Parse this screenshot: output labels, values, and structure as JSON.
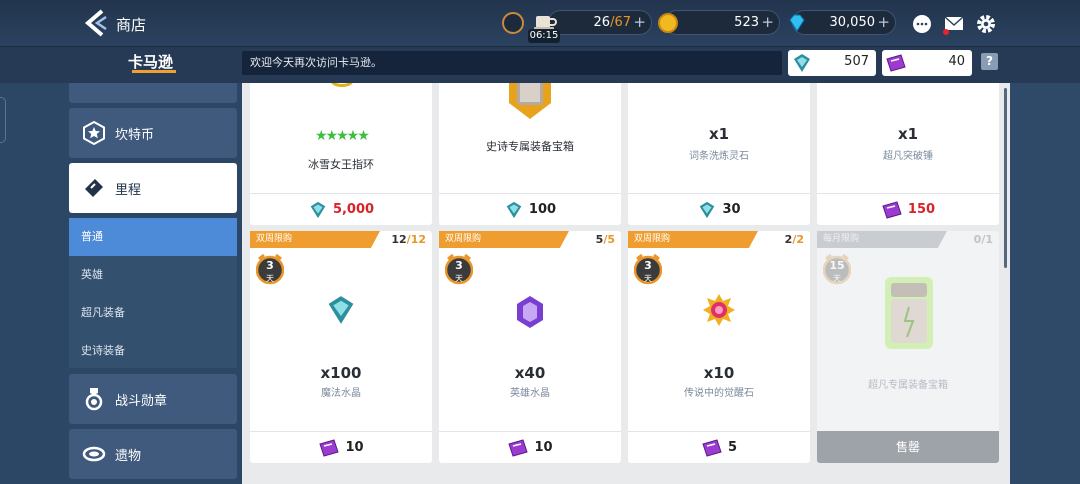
{
  "header": {
    "title": "商店",
    "energy": {
      "value": "26",
      "max": "67",
      "timer": "06:15"
    },
    "coins": "523",
    "gems": "30,050"
  },
  "subheader": {
    "brand": "卡马逊",
    "welcome": "欢迎今天再次访问卡马逊。",
    "magic_crystal": "507",
    "ticket": "40",
    "help": "?"
  },
  "sidebar": {
    "items": [
      {
        "label": "坎特币"
      },
      {
        "label": "里程"
      },
      {
        "label": "战斗勋章"
      },
      {
        "label": "遗物"
      }
    ],
    "subitems": [
      {
        "label": "普通"
      },
      {
        "label": "英雄"
      },
      {
        "label": "超凡装备"
      },
      {
        "label": "史诗装备"
      }
    ]
  },
  "top_cards": [
    {
      "qty": "",
      "name": "冰雪女王指环",
      "price": "5,000",
      "currency": "crystal-icon"
    },
    {
      "qty": "",
      "name": "史诗专属装备宝箱",
      "price": "100",
      "currency": "crystal-icon"
    },
    {
      "qty": "x1",
      "name": "词条洗炼灵石",
      "price": "30",
      "currency": "crystal-icon"
    },
    {
      "qty": "x1",
      "name": "超凡突破锤",
      "price": "150",
      "currency": "ticket-icon"
    }
  ],
  "bottom_cards": [
    {
      "banner": "双周限购",
      "count": "12",
      "max": "12",
      "days": "3",
      "days_unit": "天",
      "qty": "x100",
      "name": "魔法水晶",
      "price": "10"
    },
    {
      "banner": "双周限购",
      "count": "5",
      "max": "5",
      "days": "3",
      "days_unit": "天",
      "qty": "x40",
      "name": "英雄水晶",
      "price": "10"
    },
    {
      "banner": "双周限购",
      "count": "2",
      "max": "2",
      "days": "3",
      "days_unit": "天",
      "qty": "x10",
      "name": "传说中的觉醒石",
      "price": "5"
    },
    {
      "banner": "每月限购",
      "count": "0",
      "max": "1",
      "days": "15",
      "days_unit": "天",
      "qty": "",
      "name": "超凡专属装备宝箱",
      "soldout": "售罄"
    }
  ],
  "colors": {
    "accent": "#ef9d2e",
    "selected": "#4d8ad8",
    "price_red": "#d8232a"
  }
}
